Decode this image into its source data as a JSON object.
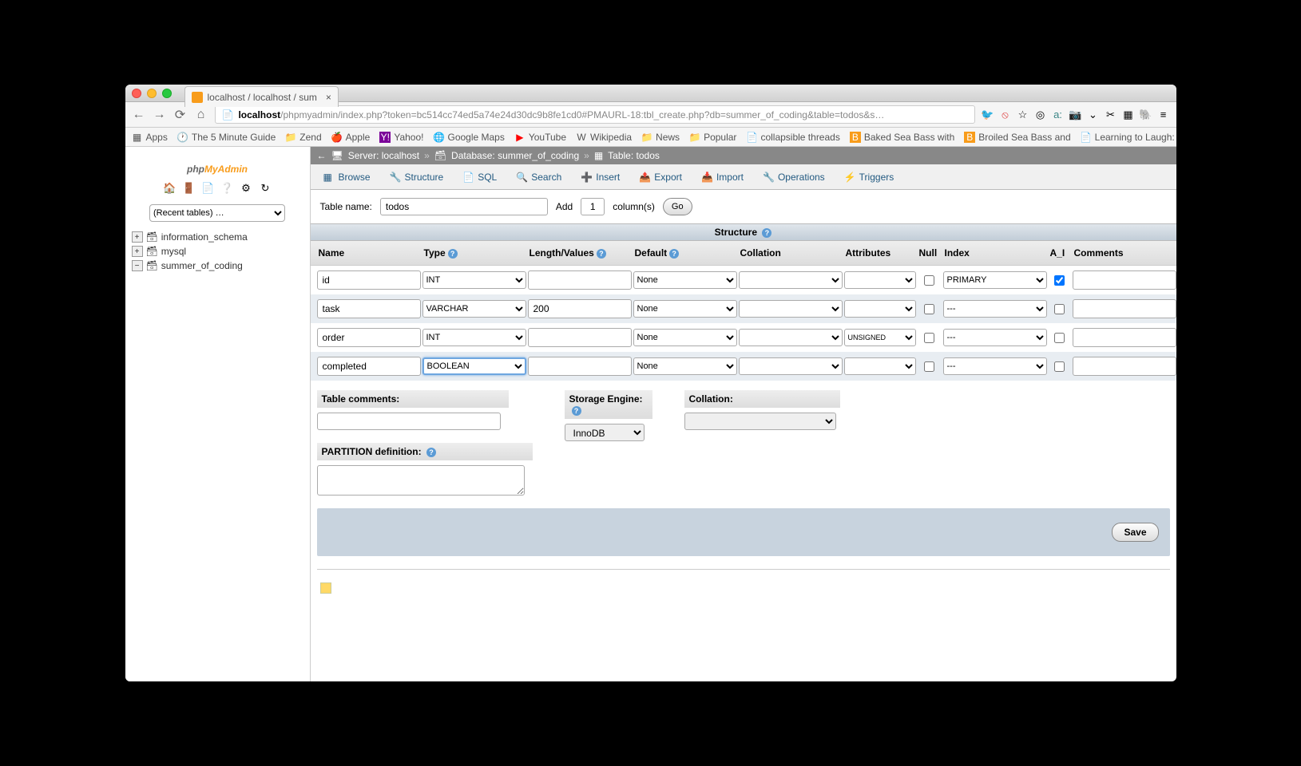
{
  "browser": {
    "tab_title": "localhost / localhost / sum",
    "url_host": "localhost",
    "url_rest": "/phpmyadmin/index.php?token=bc514cc74ed5a74e24d30dc9b8fe1cd0#PMAURL-18:tbl_create.php?db=summer_of_coding&table=todos&s…",
    "bookmarks": [
      "Apps",
      "The 5 Minute Guide",
      "Zend",
      "Apple",
      "Yahoo!",
      "Google Maps",
      "YouTube",
      "Wikipedia",
      "News",
      "Popular",
      "collapsible threads",
      "Baked Sea Bass with",
      "Broiled Sea Bass and",
      "Learning to Laugh: A"
    ]
  },
  "sidebar": {
    "recent_placeholder": "(Recent tables) …",
    "dbs": [
      "information_schema",
      "mysql",
      "summer_of_coding"
    ]
  },
  "breadcrumb": {
    "server_label": "Server: localhost",
    "db_label": "Database: summer_of_coding",
    "table_label": "Table: todos"
  },
  "tabs": [
    "Browse",
    "Structure",
    "SQL",
    "Search",
    "Insert",
    "Export",
    "Import",
    "Operations",
    "Triggers"
  ],
  "form": {
    "table_name_label": "Table name:",
    "table_name": "todos",
    "add_label": "Add",
    "add_count": "1",
    "columns_label": "column(s)",
    "go": "Go"
  },
  "structure_title": "Structure",
  "headers": {
    "name": "Name",
    "type": "Type",
    "length": "Length/Values",
    "default": "Default",
    "collation": "Collation",
    "attributes": "Attributes",
    "null": "Null",
    "index": "Index",
    "ai": "A_I",
    "comments": "Comments"
  },
  "rows": [
    {
      "name": "id",
      "type": "INT",
      "length": "",
      "default": "None",
      "collation": "",
      "attributes": "",
      "null": false,
      "index": "PRIMARY",
      "ai": true,
      "comments": ""
    },
    {
      "name": "task",
      "type": "VARCHAR",
      "length": "200",
      "default": "None",
      "collation": "",
      "attributes": "",
      "null": false,
      "index": "---",
      "ai": false,
      "comments": ""
    },
    {
      "name": "order",
      "type": "INT",
      "length": "",
      "default": "None",
      "collation": "",
      "attributes": "UNSIGNED",
      "null": false,
      "index": "---",
      "ai": false,
      "comments": ""
    },
    {
      "name": "completed",
      "type": "BOOLEAN",
      "length": "",
      "default": "None",
      "collation": "",
      "attributes": "",
      "null": false,
      "index": "---",
      "ai": false,
      "comments": "",
      "focused": true
    }
  ],
  "options": {
    "table_comments_label": "Table comments:",
    "storage_engine_label": "Storage Engine:",
    "storage_engine": "InnoDB",
    "collation_label": "Collation:",
    "partition_label": "PARTITION definition:"
  },
  "save": "Save"
}
